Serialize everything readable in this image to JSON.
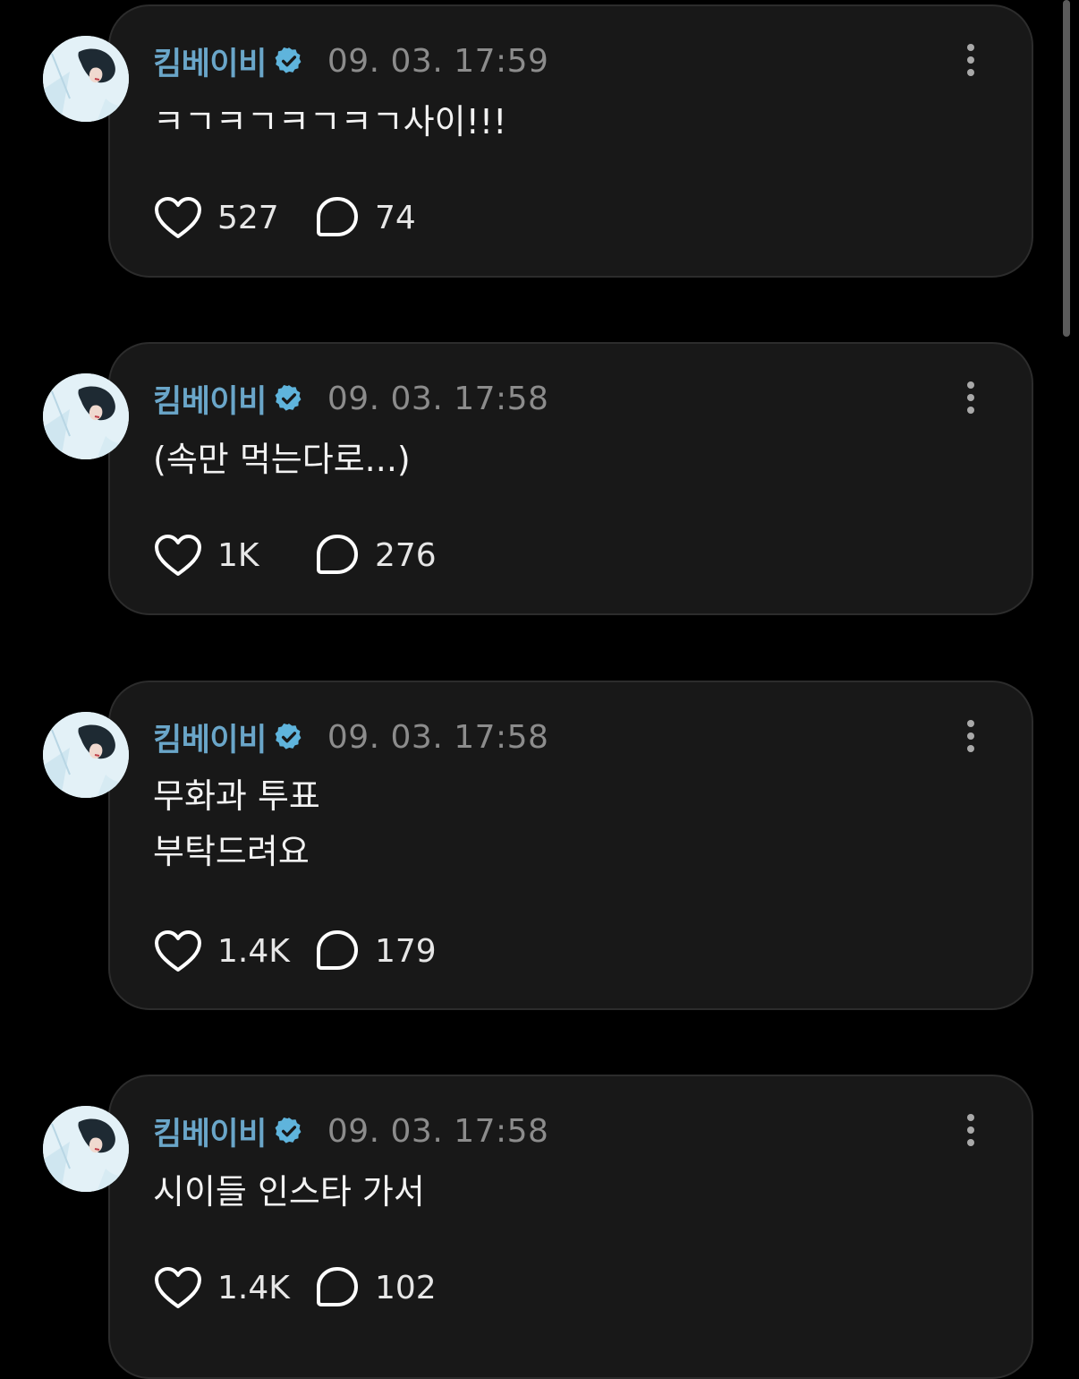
{
  "colors": {
    "background": "#000000",
    "card": "#181818",
    "username": "#6aa6c9",
    "verified_badge": "#5fb4dc",
    "timestamp": "#8c8c8c",
    "text": "#f2f2f2"
  },
  "posts": [
    {
      "username": "킴베이비",
      "timestamp": "09. 03. 17:59",
      "text": "ㅋㄱㅋㄱㅋㄱㅋㄱ사이!!!",
      "likes": "527",
      "comments": "74",
      "avatar_icon": "profile-photo",
      "verified_icon": "verified-badge-icon",
      "like_icon": "heart-icon",
      "comment_icon": "speech-bubble-icon",
      "more_icon": "kebab-menu-icon"
    },
    {
      "username": "킴베이비",
      "timestamp": "09. 03. 17:58",
      "text": "(속만 먹는다로...)",
      "likes": "1K",
      "comments": "276",
      "avatar_icon": "profile-photo",
      "verified_icon": "verified-badge-icon",
      "like_icon": "heart-icon",
      "comment_icon": "speech-bubble-icon",
      "more_icon": "kebab-menu-icon"
    },
    {
      "username": "킴베이비",
      "timestamp": "09. 03. 17:58",
      "text": "무화과 투표\n부탁드려요",
      "likes": "1.4K",
      "comments": "179",
      "avatar_icon": "profile-photo",
      "verified_icon": "verified-badge-icon",
      "like_icon": "heart-icon",
      "comment_icon": "speech-bubble-icon",
      "more_icon": "kebab-menu-icon"
    },
    {
      "username": "킴베이비",
      "timestamp": "09. 03. 17:58",
      "text": "시이들 인스타 가서",
      "likes": "1.4K",
      "comments": "102",
      "avatar_icon": "profile-photo",
      "verified_icon": "verified-badge-icon",
      "like_icon": "heart-icon",
      "comment_icon": "speech-bubble-icon",
      "more_icon": "kebab-menu-icon"
    }
  ]
}
